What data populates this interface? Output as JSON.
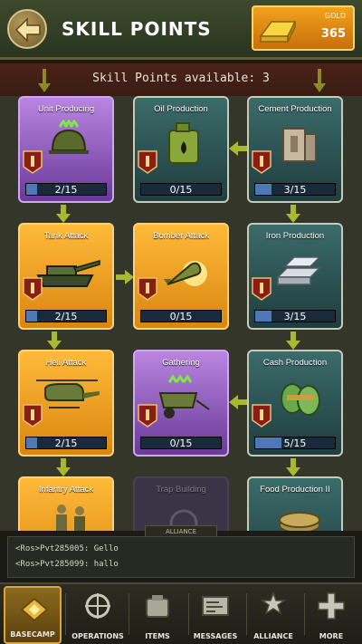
{
  "header": {
    "title": "SKILL POINTS",
    "gold_label": "GOLD",
    "gold_value": "365"
  },
  "banner": {
    "text": "Skill Points available: 3"
  },
  "skills": [
    {
      "name": "Unit Producing",
      "progress": "2/15",
      "fill": 0.133,
      "style": "purple",
      "icon": "helmet-icon"
    },
    {
      "name": "Oil Production",
      "progress": "0/15",
      "fill": 0.0,
      "style": "teal",
      "icon": "oil-canister-icon"
    },
    {
      "name": "Cement Production",
      "progress": "3/15",
      "fill": 0.2,
      "style": "teal",
      "icon": "cement-block-icon"
    },
    {
      "name": "Tank Attack",
      "progress": "2/15",
      "fill": 0.133,
      "style": "orange",
      "icon": "tank-icon"
    },
    {
      "name": "Bomber Attack",
      "progress": "0/15",
      "fill": 0.0,
      "style": "orange",
      "icon": "bomb-icon"
    },
    {
      "name": "Iron Production",
      "progress": "3/15",
      "fill": 0.2,
      "style": "teal",
      "icon": "iron-bars-icon"
    },
    {
      "name": "Heli Attack",
      "progress": "2/15",
      "fill": 0.133,
      "style": "orange",
      "icon": "helicopter-icon"
    },
    {
      "name": "Gathering",
      "progress": "0/15",
      "fill": 0.0,
      "style": "purple",
      "icon": "cart-icon"
    },
    {
      "name": "Cash Production",
      "progress": "5/15",
      "fill": 0.333,
      "style": "teal",
      "icon": "cash-roll-icon"
    },
    {
      "name": "Infantry Attack",
      "progress": "",
      "fill": 0.0,
      "style": "orange",
      "icon": "soldiers-icon"
    },
    {
      "name": "Trap Building",
      "progress": "",
      "fill": 0.0,
      "style": "locked",
      "icon": "trap-icon"
    },
    {
      "name": "Food Production II",
      "progress": "",
      "fill": 0.0,
      "style": "teal",
      "icon": "coins-icon"
    }
  ],
  "alliance_tag": "ALLIANCE",
  "chat": [
    {
      "text": "<Ros>Pvt285005: Gello"
    },
    {
      "text": "<Ros>Pvt285099: hallo"
    }
  ],
  "nav": [
    {
      "label": "BASECAMP",
      "icon": "basecamp-icon",
      "active": true
    },
    {
      "label": "OPERATIONS",
      "icon": "operations-icon",
      "active": false
    },
    {
      "label": "ITEMS",
      "icon": "items-icon",
      "active": false
    },
    {
      "label": "MESSAGES",
      "icon": "messages-icon",
      "active": false
    },
    {
      "label": "ALLIANCE",
      "icon": "alliance-icon",
      "active": false
    },
    {
      "label": "MORE",
      "icon": "plus-icon",
      "active": false
    }
  ],
  "colors": {
    "purple": "#8a55b8",
    "teal": "#2f5556",
    "orange": "#f0a020",
    "gold": "#e0901a"
  }
}
